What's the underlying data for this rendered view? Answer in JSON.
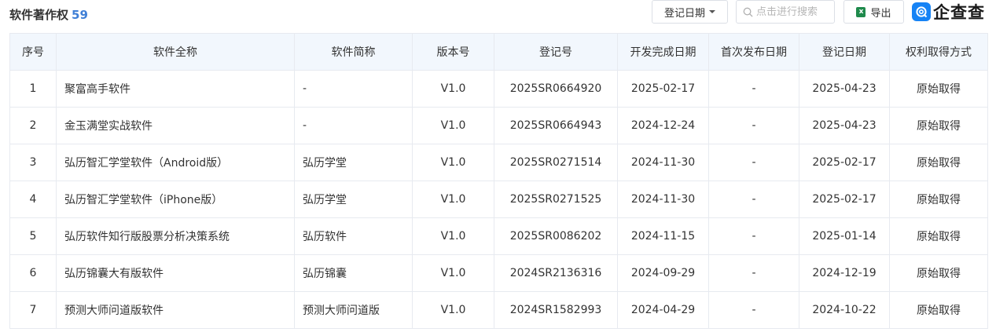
{
  "section": {
    "title": "软件著作权",
    "count": "59"
  },
  "toolbar": {
    "date_filter_label": "登记日期",
    "search_placeholder": "点击进行搜索",
    "export_label": "导出",
    "export_icon": "excel-icon",
    "logo_text": "企查查"
  },
  "table": {
    "headers": [
      "序号",
      "软件全称",
      "软件简称",
      "版本号",
      "登记号",
      "开发完成日期",
      "首次发布日期",
      "登记日期",
      "权利取得方式"
    ],
    "rows": [
      [
        "1",
        "聚富高手软件",
        "-",
        "V1.0",
        "2025SR0664920",
        "2025-02-17",
        "-",
        "2025-04-23",
        "原始取得"
      ],
      [
        "2",
        "金玉满堂实战软件",
        "-",
        "V1.0",
        "2025SR0664943",
        "2024-12-24",
        "-",
        "2025-04-23",
        "原始取得"
      ],
      [
        "3",
        "弘历智汇学堂软件（Android版）",
        "弘历学堂",
        "V1.0",
        "2025SR0271514",
        "2024-11-30",
        "-",
        "2025-02-17",
        "原始取得"
      ],
      [
        "4",
        "弘历智汇学堂软件（iPhone版）",
        "弘历学堂",
        "V1.0",
        "2025SR0271525",
        "2024-11-30",
        "-",
        "2025-02-17",
        "原始取得"
      ],
      [
        "5",
        "弘历软件知行版股票分析决策系统",
        "弘历软件",
        "V1.0",
        "2025SR0086202",
        "2024-11-15",
        "-",
        "2025-01-14",
        "原始取得"
      ],
      [
        "6",
        "弘历锦囊大有版软件",
        "弘历锦囊",
        "V1.0",
        "2024SR2136316",
        "2024-09-29",
        "-",
        "2024-12-19",
        "原始取得"
      ],
      [
        "7",
        "预测大师问道版软件",
        "预测大师问道版",
        "V1.0",
        "2024SR1582993",
        "2024-04-29",
        "-",
        "2024-10-22",
        "原始取得"
      ]
    ]
  }
}
